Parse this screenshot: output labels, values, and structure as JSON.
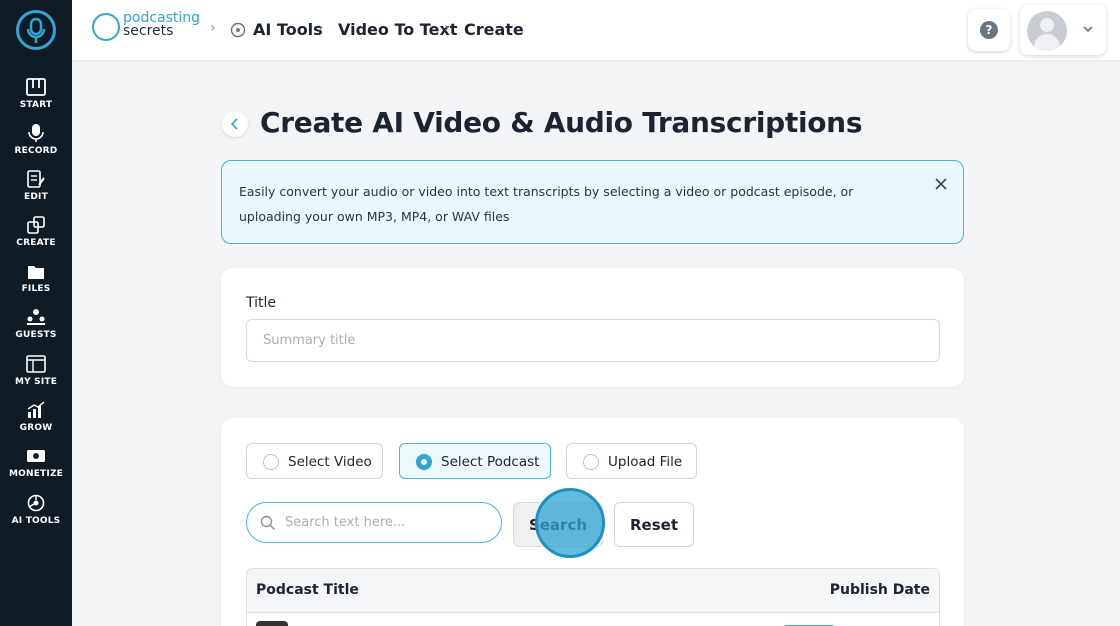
{
  "sidebar": {
    "items": [
      {
        "label": "START",
        "icon": "piano-icon"
      },
      {
        "label": "RECORD",
        "icon": "microphone-icon"
      },
      {
        "label": "EDIT",
        "icon": "edit-icon"
      },
      {
        "label": "CREATE",
        "icon": "create-icon"
      },
      {
        "label": "FILES",
        "icon": "folder-icon"
      },
      {
        "label": "GUESTS",
        "icon": "guests-icon"
      },
      {
        "label": "MY SITE",
        "icon": "website-icon"
      },
      {
        "label": "GROW",
        "icon": "chart-icon"
      },
      {
        "label": "MONETIZE",
        "icon": "monetize-icon"
      },
      {
        "label": "AI TOOLS",
        "icon": "ai-icon"
      }
    ]
  },
  "header": {
    "brand_line1": "podcasting",
    "brand_line2": "secrets",
    "breadcrumb": [
      "AI Tools",
      "Video To Text",
      "Create"
    ],
    "help_label": "?"
  },
  "page": {
    "title": "Create AI Video & Audio Transcriptions",
    "alert": "Easily convert your audio or video into text transcripts by selecting a video or podcast episode, or uploading your own MP3, MP4, or WAV files"
  },
  "title_card": {
    "label": "Title",
    "placeholder": "Summary title"
  },
  "source_card": {
    "options": [
      {
        "label": "Select Video",
        "selected": false
      },
      {
        "label": "Select Podcast",
        "selected": true
      },
      {
        "label": "Upload File",
        "selected": false
      }
    ],
    "search_placeholder": "Search text here...",
    "search_label": "Search",
    "reset_label": "Reset",
    "table_headers": [
      "Podcast Title",
      "Publish Date"
    ]
  },
  "colors": {
    "accent": "#2fa6d3",
    "sidebar": "#0f1c26",
    "alert_bg": "#eaf8fb"
  }
}
